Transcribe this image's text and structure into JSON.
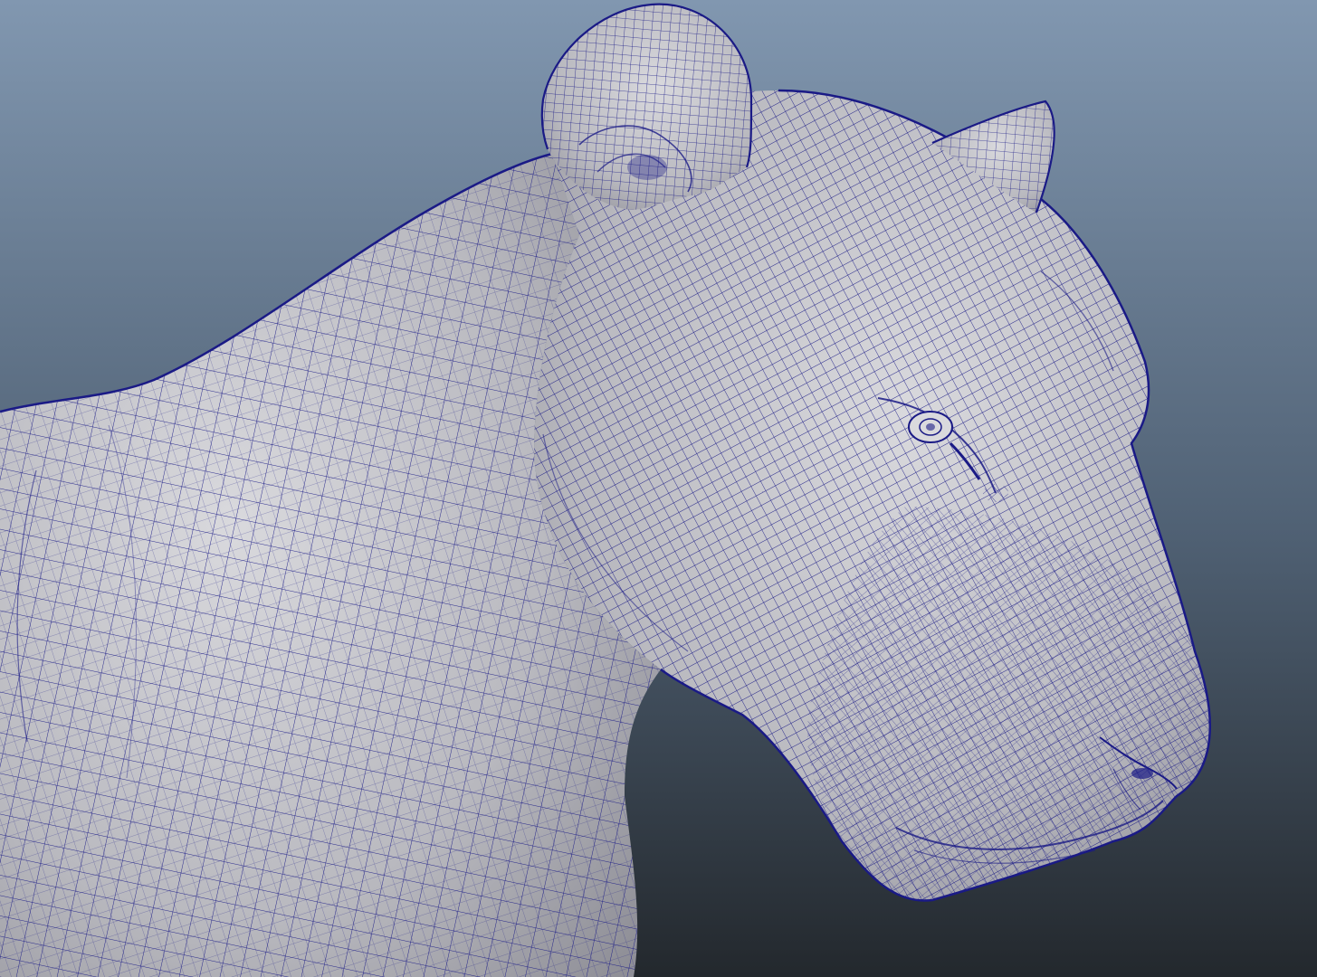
{
  "scene": {
    "subject": "wireframe-panther-head-model",
    "colors": {
      "background_top": "#8197b0",
      "background_mid": "#4f6073",
      "background_bottom": "#23282d",
      "surface": "#b9b9bf",
      "surface_shadow": "#8f8f97",
      "surface_highlight": "#d9d9dd",
      "wire": "#1a1a86"
    },
    "mesh": {
      "density": "high",
      "shading": "smooth-with-wireframe-overlay"
    }
  }
}
